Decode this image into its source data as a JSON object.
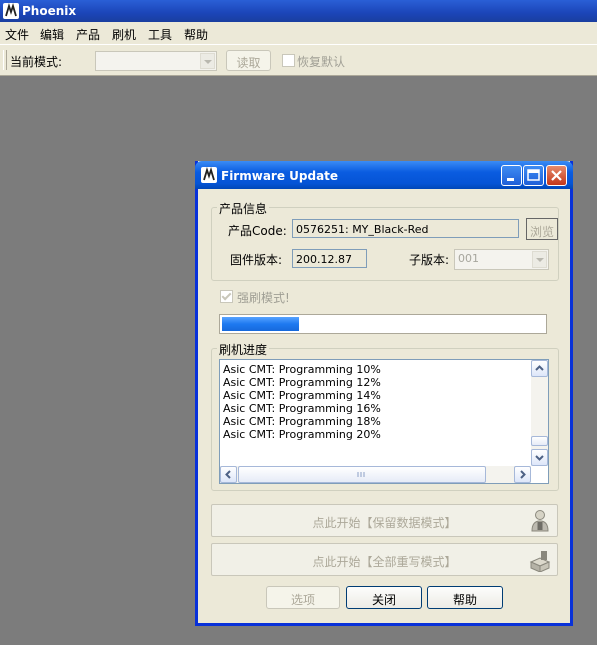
{
  "app": {
    "title": "Phoenix",
    "menu": [
      "文件",
      "编辑",
      "产品",
      "刷机",
      "工具",
      "帮助"
    ],
    "toolbar": {
      "mode_label": "当前模式:",
      "mode_value": "",
      "read_button": "读取",
      "restore_default_label": "恢复默认"
    }
  },
  "dialog": {
    "title": "Firmware Update",
    "product_group": {
      "legend": "产品信息",
      "code_label": "产品Code:",
      "code_value": "0576251: MY_Black-Red",
      "browse_button": "浏览",
      "firmware_label": "固件版本:",
      "firmware_value": "200.12.87",
      "subversion_label": "子版本:",
      "subversion_value": "001"
    },
    "force_mode_label": "强刷模式!",
    "force_mode_checked": true,
    "progress_percent": 24,
    "log_group": {
      "legend": "刷机进度",
      "lines": [
        "Asic CMT: Programming  10%",
        "Asic CMT: Programming  12%",
        "Asic CMT: Programming  14%",
        "Asic CMT: Programming  16%",
        "Asic CMT: Programming  18%",
        "Asic CMT: Programming  20%"
      ]
    },
    "start_keep_data_button": "点此开始【保留数据模式】",
    "start_full_rewrite_button": "点此开始【全部重写模式】",
    "options_button": "选项",
    "close_button": "关闭",
    "help_button": "帮助"
  },
  "colors": {
    "desktop": "#7c7c7c",
    "titlebar": "#0554d6",
    "progress": "#1e79f0",
    "window_face": "#ece9d8"
  }
}
